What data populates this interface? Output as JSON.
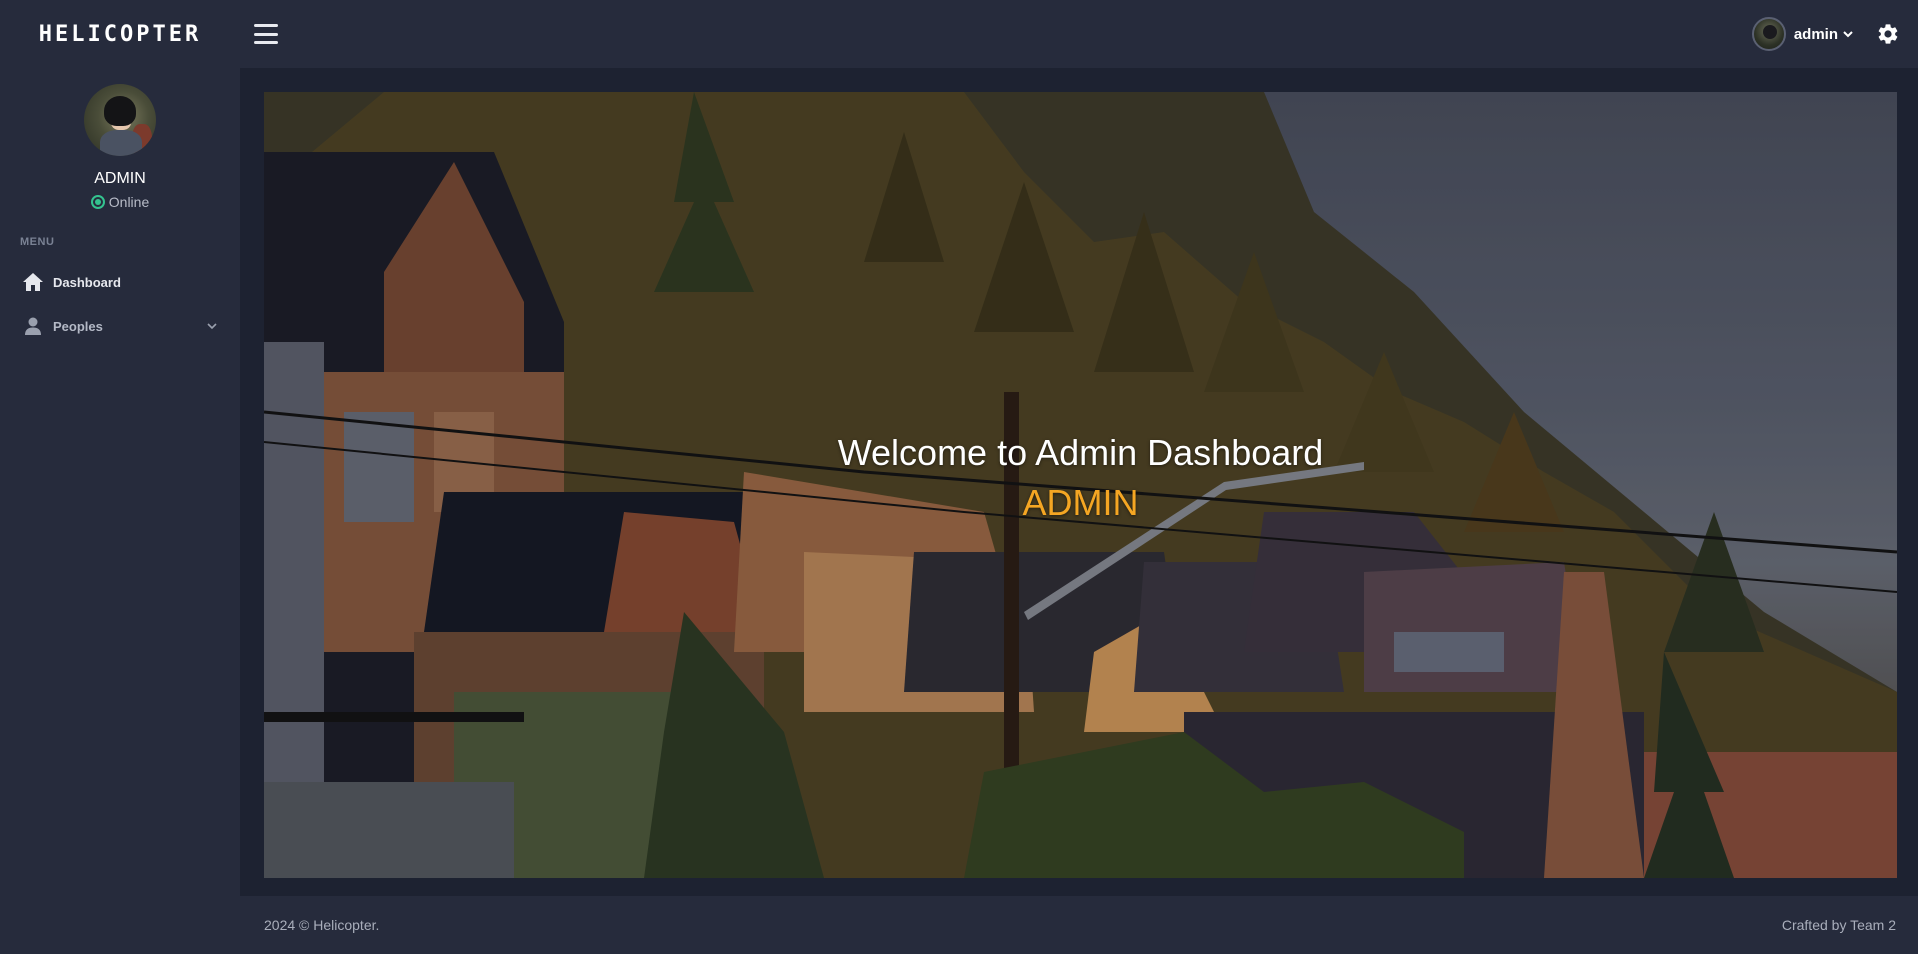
{
  "header": {
    "brand": "HELICOPTER",
    "user_name": "admin"
  },
  "sidebar": {
    "profile_name": "ADMIN",
    "status": "Online",
    "menu_title": "MENU",
    "items": [
      {
        "label": "Dashboard",
        "icon": "home-icon"
      },
      {
        "label": "Peoples",
        "icon": "user-icon"
      }
    ]
  },
  "hero": {
    "welcome": "Welcome to Admin Dashboard",
    "role": "ADMIN"
  },
  "footer": {
    "copyright": "2024 © Helicopter.",
    "credit": "Crafted by Team 2"
  },
  "colors": {
    "accent": "#f5a623",
    "online": "#34c38f",
    "topbar": "#262b3c",
    "background": "#1d2231"
  }
}
